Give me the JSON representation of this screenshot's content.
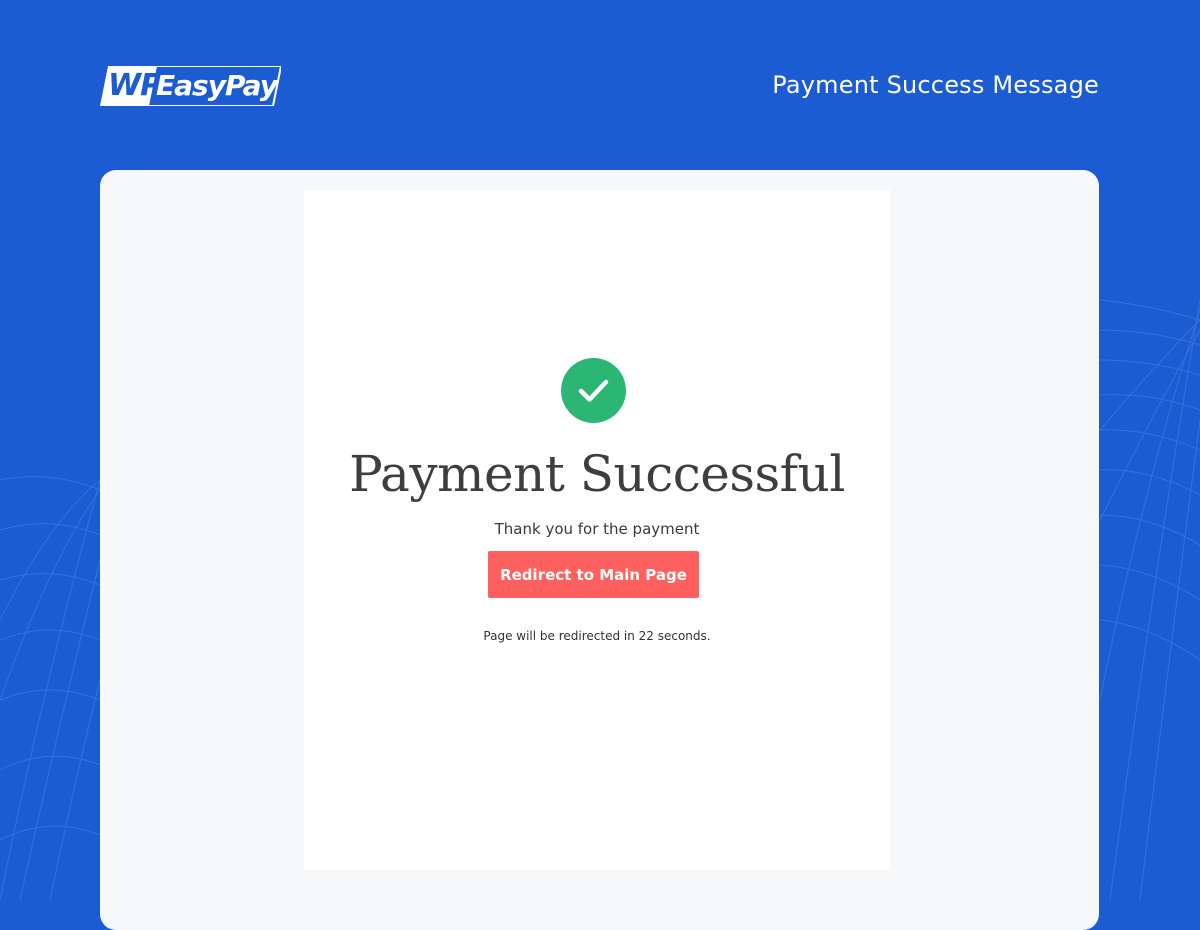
{
  "brand": {
    "logo_wp": "WP",
    "logo_name": "EasyPay",
    "background_color": "#1b5cd3"
  },
  "header": {
    "title": "Payment Success Message"
  },
  "success": {
    "icon": "check-circle-icon",
    "icon_color": "#2bb673",
    "title": "Payment Successful",
    "message": "Thank you for the payment",
    "button_label": "Redirect to Main Page",
    "button_color": "#fe5f5f",
    "countdown_text": "Page will be redirected in 22 seconds."
  }
}
